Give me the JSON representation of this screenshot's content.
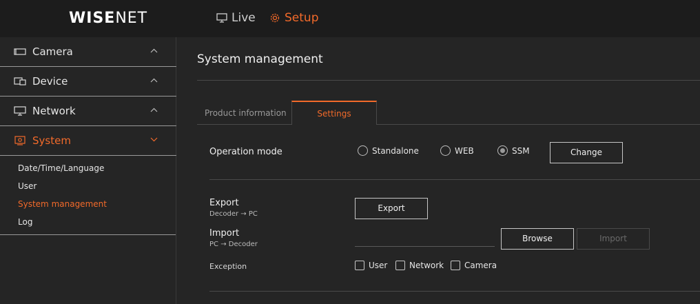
{
  "header": {
    "logo_bold": "WISE",
    "logo_thin": "NET",
    "live_label": "Live",
    "setup_label": "Setup"
  },
  "sidebar": {
    "menus": [
      {
        "label": "Camera"
      },
      {
        "label": "Device"
      },
      {
        "label": "Network"
      },
      {
        "label": "System"
      }
    ],
    "system_items": [
      {
        "label": "Date/Time/Language"
      },
      {
        "label": "User"
      },
      {
        "label": "System management"
      },
      {
        "label": "Log"
      }
    ]
  },
  "page": {
    "title": "System management"
  },
  "tabs": {
    "product_info": "Product information",
    "settings": "Settings"
  },
  "operation_mode": {
    "label": "Operation mode",
    "options": [
      "Standalone",
      "WEB",
      "SSM"
    ],
    "selected": "SSM",
    "change_label": "Change"
  },
  "export": {
    "title": "Export",
    "subtitle": "Decoder → PC",
    "button": "Export"
  },
  "import": {
    "title": "Import",
    "subtitle": "PC → Decoder",
    "browse_button": "Browse",
    "import_button": "Import"
  },
  "exception": {
    "label": "Exception",
    "options": [
      "User",
      "Network",
      "Camera"
    ]
  },
  "colors": {
    "accent": "#f26a2a",
    "background": "#252525",
    "header": "#1c1c1c"
  }
}
